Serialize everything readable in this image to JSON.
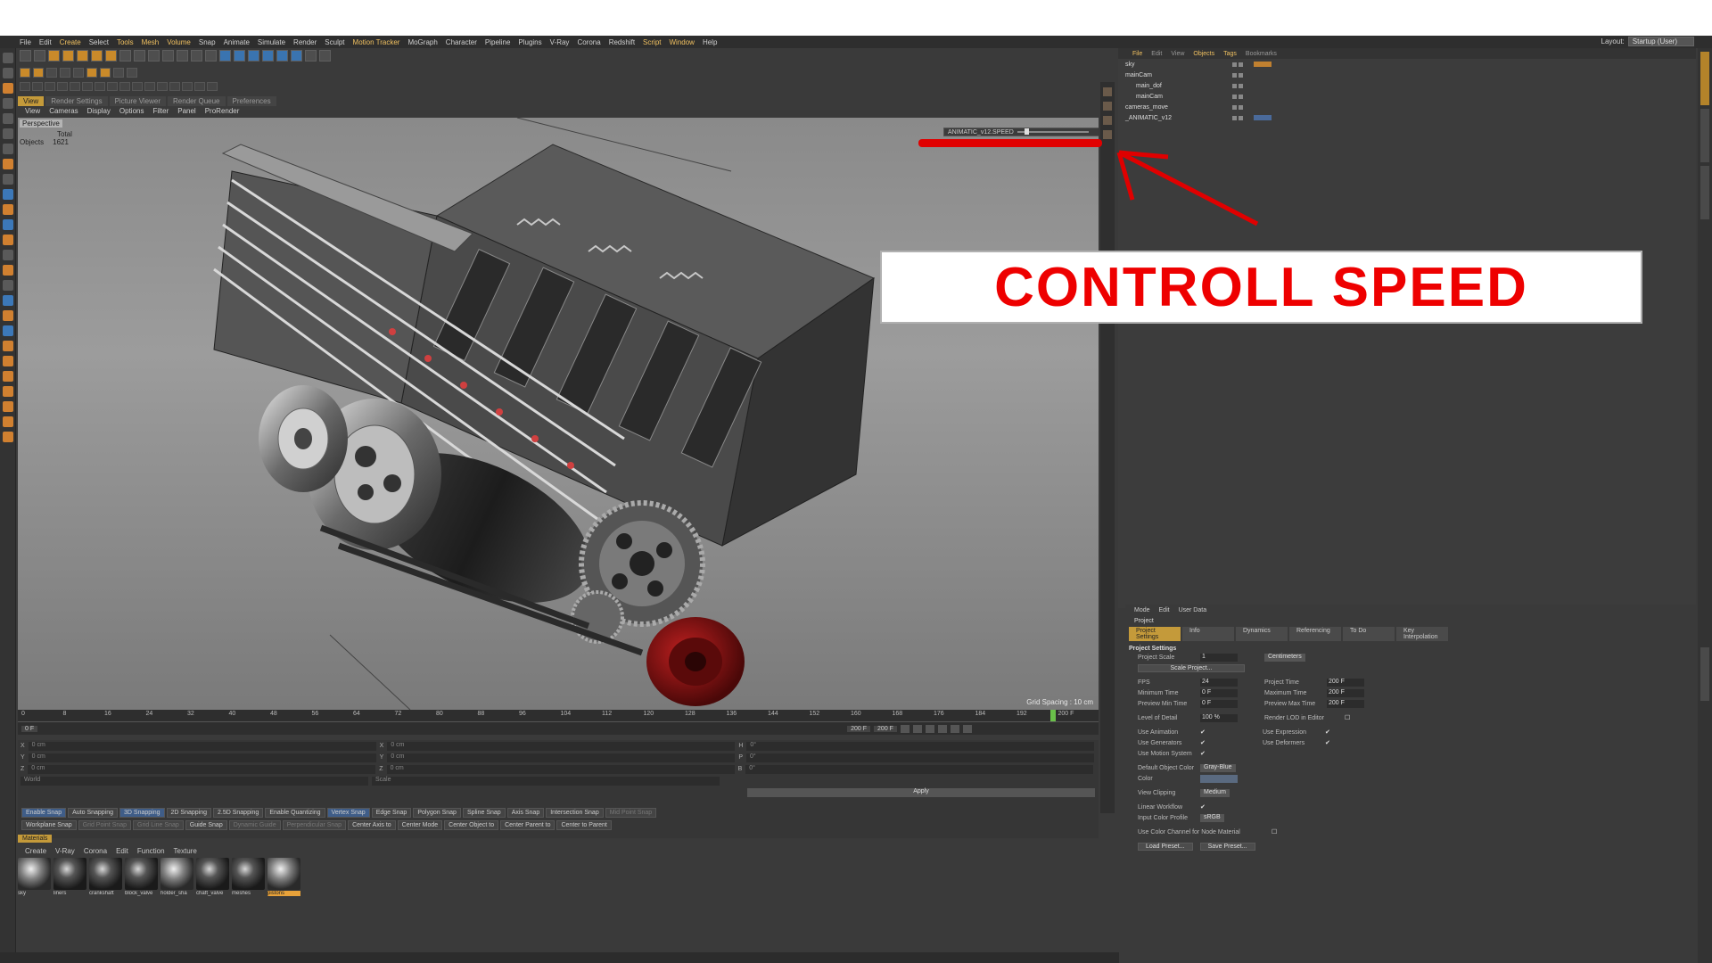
{
  "menubar": [
    "File",
    "Edit",
    "Create",
    "Select",
    "Tools",
    "Mesh",
    "Volume",
    "Snap",
    "Animate",
    "Simulate",
    "Render",
    "Sculpt",
    "Motion Tracker",
    "MoGraph",
    "Character",
    "Pipeline",
    "Plugins",
    "V-Ray",
    "Corona",
    "Redshift",
    "Script",
    "Window",
    "Help"
  ],
  "layout": {
    "label": "Layout:",
    "value": "Startup (User)"
  },
  "panel_tabs": [
    "View",
    "Render Settings",
    "Picture Viewer",
    "Render Queue",
    "Preferences"
  ],
  "view_menu": [
    "View",
    "Cameras",
    "Display",
    "Options",
    "Filter",
    "Panel",
    "ProRender"
  ],
  "viewport": {
    "label": "Perspective",
    "stats_header": "Total",
    "stats_label": "Objects",
    "stats_value": "1621",
    "grid_spacing": "Grid Spacing : 10 cm",
    "speed_label": "ANIMATIC_v12.SPEED",
    "speed_value": "20"
  },
  "timeline": {
    "ticks": [
      "0",
      "8",
      "16",
      "24",
      "32",
      "40",
      "48",
      "56",
      "64",
      "72",
      "80",
      "88",
      "96",
      "104",
      "112",
      "120",
      "128",
      "136",
      "144",
      "152",
      "160",
      "168",
      "176",
      "184",
      "192",
      "200 F"
    ],
    "current": "0 F",
    "start": "0 F",
    "end": "200 F",
    "end2": "200 F"
  },
  "coords": {
    "rows": [
      {
        "a": "X",
        "av": "0 cm",
        "b": "X",
        "bv": "0 cm",
        "c": "H",
        "cv": "0°"
      },
      {
        "a": "Y",
        "av": "0 cm",
        "b": "Y",
        "bv": "0 cm",
        "c": "P",
        "cv": "0°"
      },
      {
        "a": "Z",
        "av": "0 cm",
        "b": "Z",
        "bv": "0 cm",
        "c": "B",
        "cv": "0°"
      }
    ],
    "mode1": "World",
    "mode2": "Scale",
    "apply": "Apply"
  },
  "snap": {
    "row1": [
      "Enable Snap",
      "Auto Snapping",
      "3D Snapping",
      "2D Snapping",
      "2.5D Snapping",
      "Enable Quantizing",
      "Vertex Snap",
      "Edge Snap",
      "Polygon Snap",
      "Spline Snap",
      "Axis Snap",
      "Intersection Snap",
      "Mid Point Snap"
    ],
    "row2": [
      "Workplane Snap",
      "Grid Point Snap",
      "Grid Line Snap",
      "Guide Snap",
      "Dynamic Guide",
      "Perpendicular Snap",
      "Center Axis to",
      "Center Mode",
      "Center Object to",
      "Center Parent to",
      "Center to Parent"
    ]
  },
  "materials": {
    "tab": "Materials",
    "menu": [
      "Create",
      "V-Ray",
      "Corona",
      "Edit",
      "Function",
      "Texture"
    ],
    "items": [
      "sky",
      "liners",
      "crankshaft",
      "block_valve",
      "holder_sha",
      "chaft_valve",
      "meshes",
      "pistons"
    ]
  },
  "objects": {
    "menu": [
      "File",
      "Edit",
      "View",
      "Objects",
      "Tags",
      "Bookmarks"
    ],
    "rows": [
      "sky",
      "mainCam",
      "main_dof",
      "mainCam",
      "cameras_move",
      "_ANIMATIC_v12"
    ]
  },
  "attributes": {
    "menu": [
      "Mode",
      "Edit",
      "User Data"
    ],
    "title": "Project",
    "tabs": [
      "Project Settings",
      "Info",
      "Dynamics",
      "Referencing",
      "To Do",
      "Key Interpolation"
    ],
    "section": "Project Settings",
    "project_scale_label": "Project Scale",
    "project_scale_value": "1",
    "project_scale_unit": "Centimeters",
    "scale_project_btn": "Scale Project...",
    "fps_label": "FPS",
    "fps_value": "24",
    "project_time_label": "Project Time",
    "project_time_value": "200 F",
    "min_time_label": "Minimum Time",
    "min_time_value": "0 F",
    "max_time_label": "Maximum Time",
    "max_time_value": "200 F",
    "prev_min_label": "Preview Min Time",
    "prev_min_value": "0 F",
    "prev_max_label": "Preview Max Time",
    "prev_max_value": "200 F",
    "lod_label": "Level of Detail",
    "lod_value": "100 %",
    "render_lod_label": "Render LOD in Editor",
    "use_anim": "Use Animation",
    "use_expr": "Use Expression",
    "use_gen": "Use Generators",
    "use_def": "Use Deformers",
    "use_motion": "Use Motion System",
    "def_color_label": "Default Object Color",
    "def_color_value": "Gray-Blue",
    "color_label": "Color",
    "view_clip_label": "View Clipping",
    "view_clip_value": "Medium",
    "linear_label": "Linear Workflow",
    "icp_label": "Input Color Profile",
    "icp_value": "sRGB",
    "color_channel_label": "Use Color Channel for Node Material",
    "load_preset": "Load Preset...",
    "save_preset": "Save Preset..."
  },
  "annotation": {
    "text": "CONTROLL SPEED",
    "color": "#ee0000"
  }
}
